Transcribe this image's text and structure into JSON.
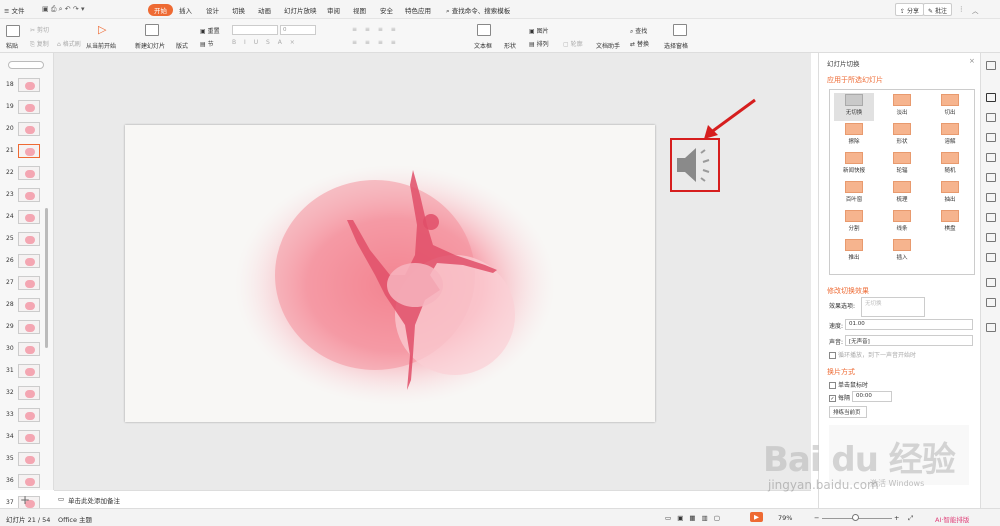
{
  "menubar": {
    "file": "文件",
    "tabs": [
      "开始",
      "插入",
      "设计",
      "切换",
      "动画",
      "幻灯片放映",
      "审阅",
      "视图",
      "安全",
      "特色应用"
    ],
    "search": "查找命令、搜索模板",
    "share": "分享",
    "comment": "批注"
  },
  "ribbon": {
    "paste": "粘贴",
    "cut": "剪切",
    "copy": "复制",
    "format_painter": "格式刷",
    "from_current": "从当前开始",
    "new_slide": "新建幻灯片",
    "layout": "版式",
    "reset": "重置",
    "section": "节",
    "font_value": "0",
    "textbox": "文本框",
    "shape": "形状",
    "arrange": "排列",
    "picture": "图片",
    "outline": "轮廓",
    "find": "查找",
    "replace": "替换",
    "doc_helper": "文档助手",
    "select_pane": "选择窗格"
  },
  "thumbnails": [
    {
      "n": "18"
    },
    {
      "n": "19"
    },
    {
      "n": "20"
    },
    {
      "n": "21"
    },
    {
      "n": "22"
    },
    {
      "n": "23"
    },
    {
      "n": "24"
    },
    {
      "n": "25"
    },
    {
      "n": "26"
    },
    {
      "n": "27"
    },
    {
      "n": "28"
    },
    {
      "n": "29"
    },
    {
      "n": "30"
    },
    {
      "n": "31"
    },
    {
      "n": "32"
    },
    {
      "n": "33"
    },
    {
      "n": "34"
    },
    {
      "n": "35"
    },
    {
      "n": "36"
    },
    {
      "n": "37"
    }
  ],
  "notes_placeholder": "单击此处添加备注",
  "panel": {
    "title": "幻灯片切换",
    "apply_heading": "应用于所选幻灯片",
    "transitions": [
      "无切换",
      "淡出",
      "切出",
      "擦除",
      "形状",
      "溶解",
      "新闻快报",
      "轮辐",
      "随机",
      "百叶窗",
      "梳理",
      "抽出",
      "分割",
      "线条",
      "棋盘",
      "推出",
      "插入"
    ],
    "modify_heading": "修改切换效果",
    "effect_label": "效果选项:",
    "effect_value": "无切换",
    "speed_label": "速度:",
    "speed_value": "01.00",
    "sound_label": "声音:",
    "sound_value": "[无声音]",
    "loop_label": "循环播放，到下一声音开始时",
    "advance_heading": "换片方式",
    "on_click": "单击鼠标时",
    "every": "每隔",
    "every_value": "00:00",
    "rehearse": "排练当前页"
  },
  "status": {
    "slide_info": "幻灯片 21 / 54",
    "theme": "Office 主题",
    "zoom": "79%",
    "ai": "AI·智能排版"
  },
  "watermark": {
    "main": "Bai du 经验",
    "sub": "jingyan.baidu.com",
    "win": "激活 Windows"
  }
}
